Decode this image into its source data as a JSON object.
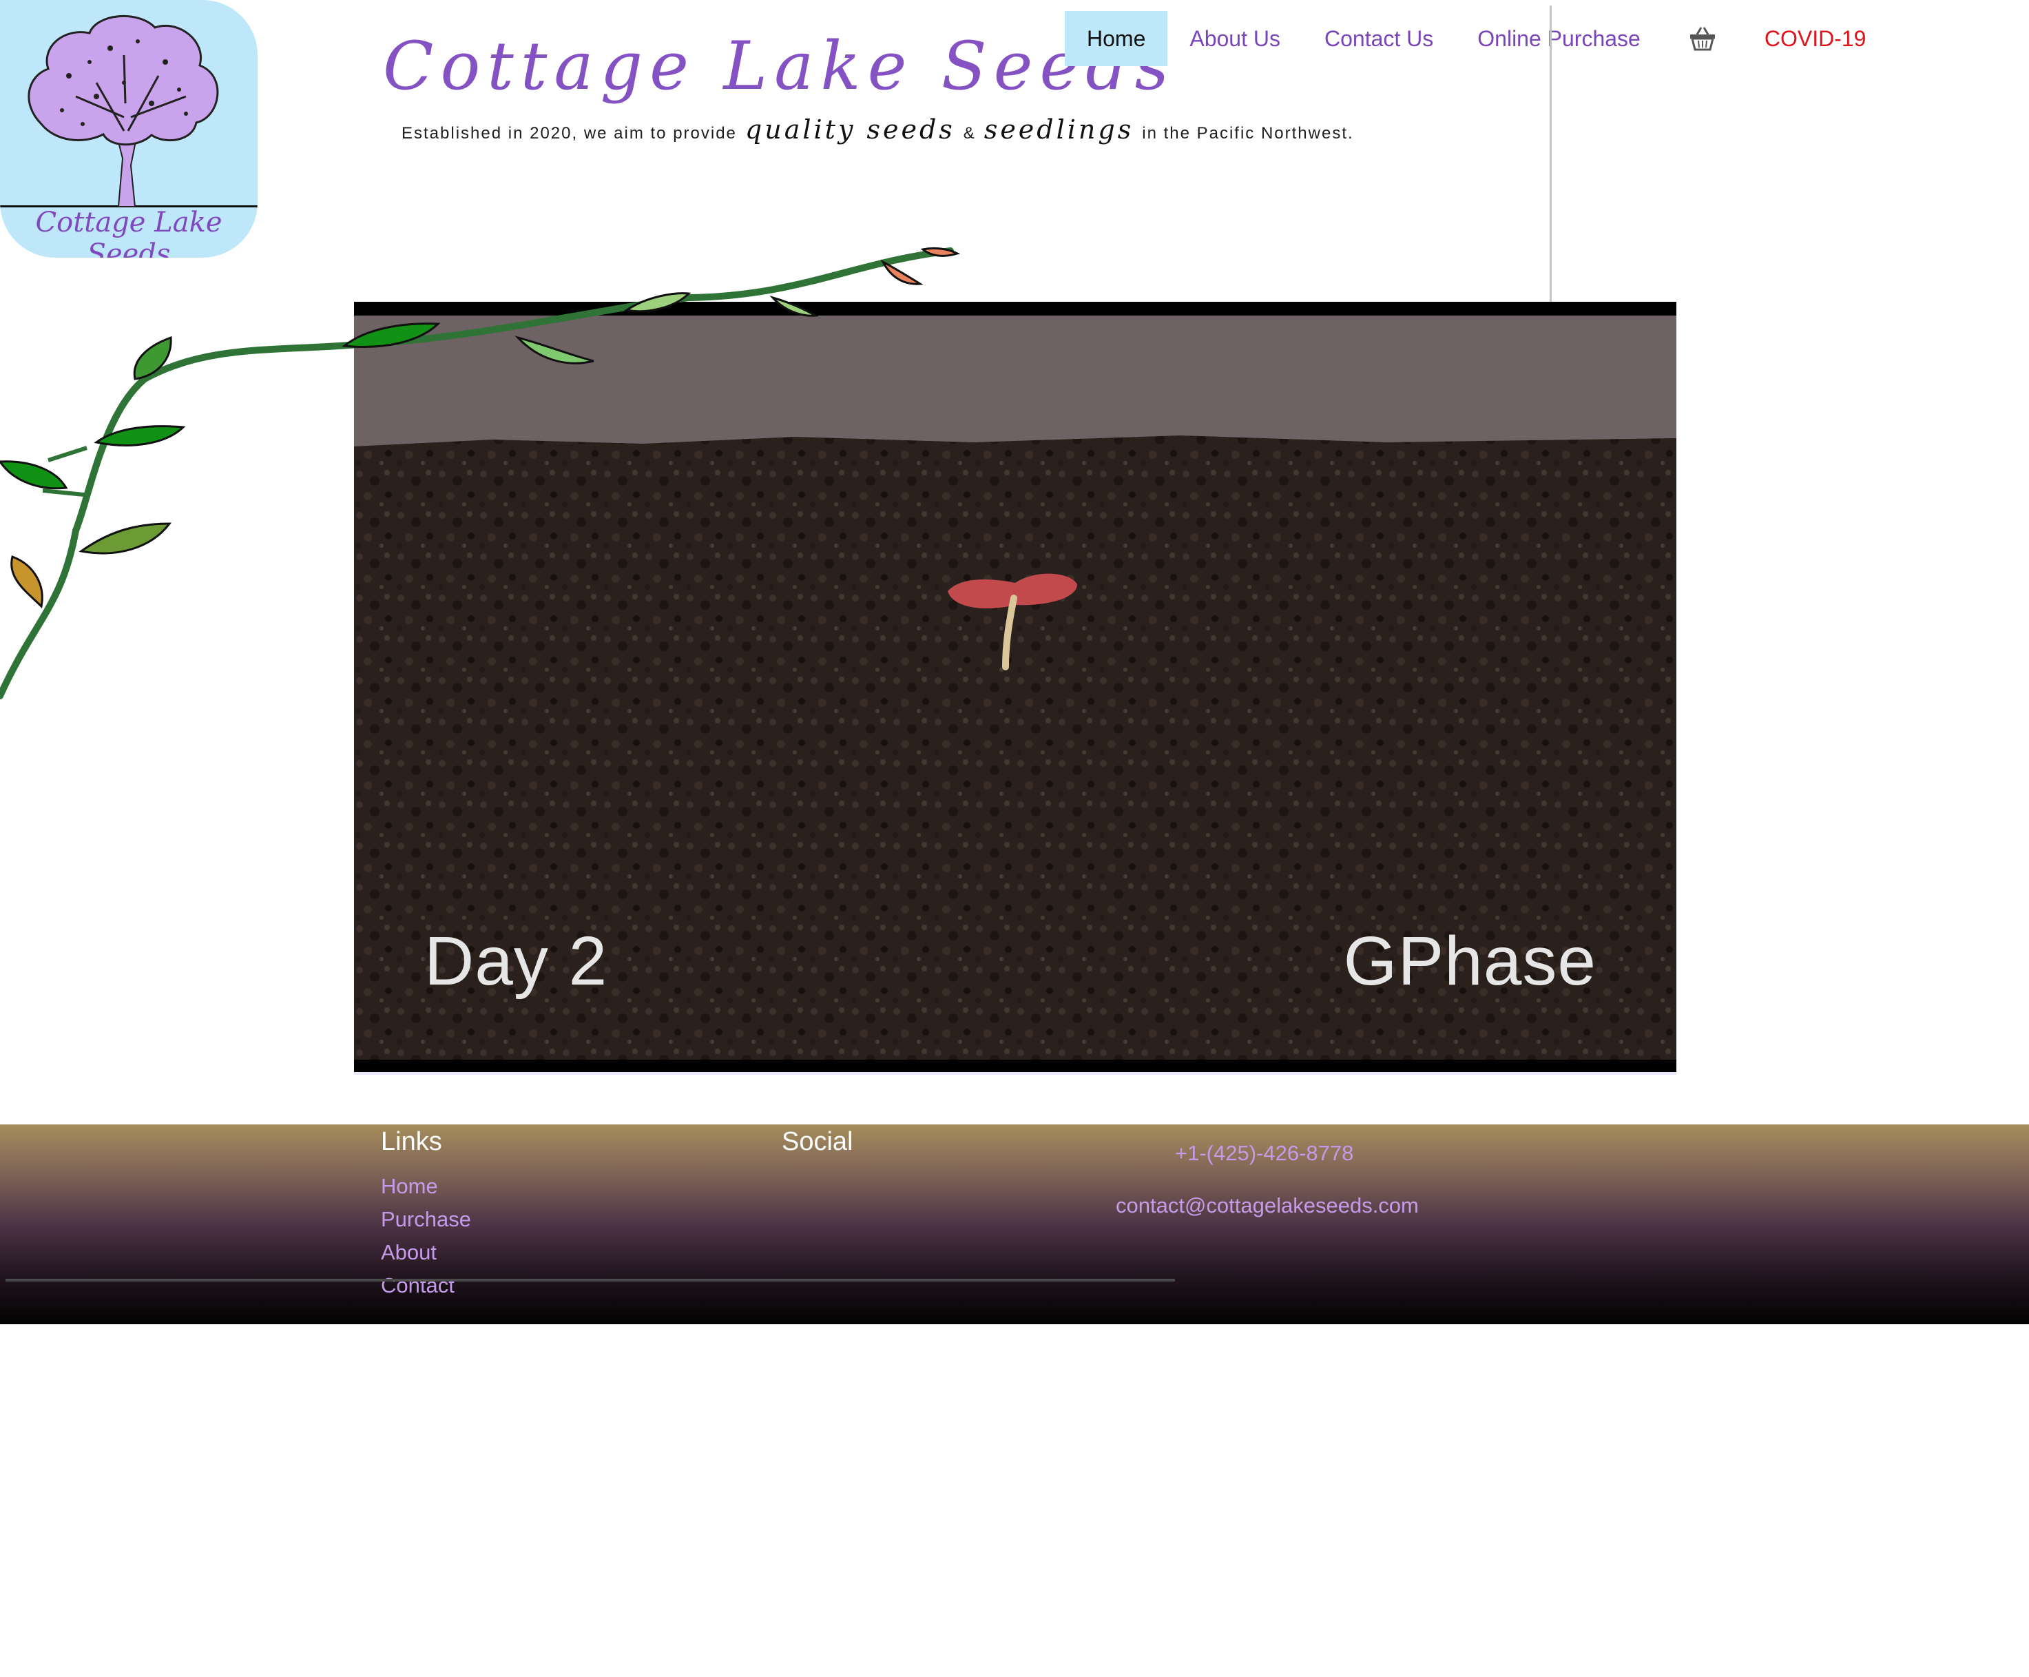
{
  "logo": {
    "text": "Cottage Lake Seeds",
    "colors": {
      "background": "#bfe7fa",
      "tree": "#c9a3ec",
      "text": "#7f49bd"
    }
  },
  "brand": {
    "name": "Cottage Lake Seeds",
    "tagline_prefix": "Established in 2020, we aim to provide",
    "tagline_quality": "quality seeds",
    "tagline_amp": "&",
    "tagline_seedlings": "seedlings",
    "tagline_suffix": "in the Pacific Northwest."
  },
  "nav": {
    "items": [
      {
        "label": "Home",
        "active": true
      },
      {
        "label": "About Us"
      },
      {
        "label": "Contact Us"
      },
      {
        "label": "Online Purchase"
      }
    ],
    "cart_icon": "shopping-basket-icon",
    "covid_label": "COVID-19",
    "colors": {
      "link": "#7a45bb",
      "active_bg": "#bfe7fa",
      "covid": "#e0121c"
    }
  },
  "hero": {
    "day_label": "Day 2",
    "phase_label": "GPhase"
  },
  "footer": {
    "links_heading": "Links",
    "links": [
      "Home",
      "Purchase",
      "About",
      "Contact"
    ],
    "social_heading": "Social",
    "phone": "+1-(425)-426-8778",
    "email": "contact@cottagelakeseeds.com",
    "colors": {
      "link": "#c59be9",
      "heading": "#ffffff"
    }
  }
}
